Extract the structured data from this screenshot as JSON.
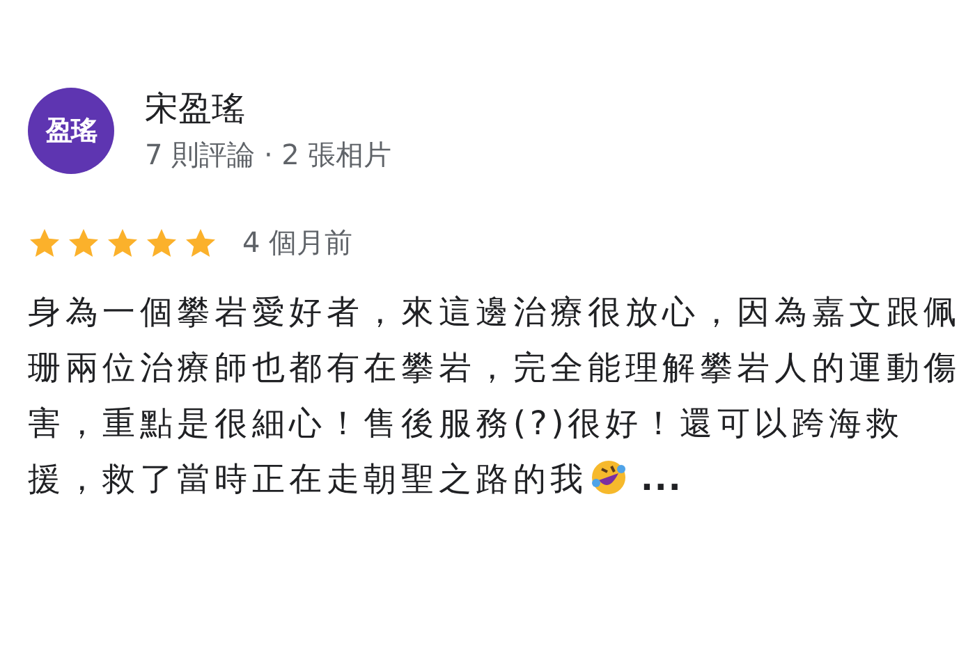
{
  "reviewer": {
    "avatar_text": "盈瑤",
    "name": "宋盈瑤",
    "stats": "7 則評論 · 2 張相片"
  },
  "review": {
    "stars": 5,
    "time": "4 個月前",
    "text": "身為一個攀岩愛好者，來這邊治療很放心，因為嘉文跟佩珊兩位治療師也都有在攀岩，完全能理解攀岩人的運動傷害，重點是很細心！售後服務(?)很好！還可以跨海救援，救了當時正在走朝聖之路的我",
    "more": "..."
  }
}
